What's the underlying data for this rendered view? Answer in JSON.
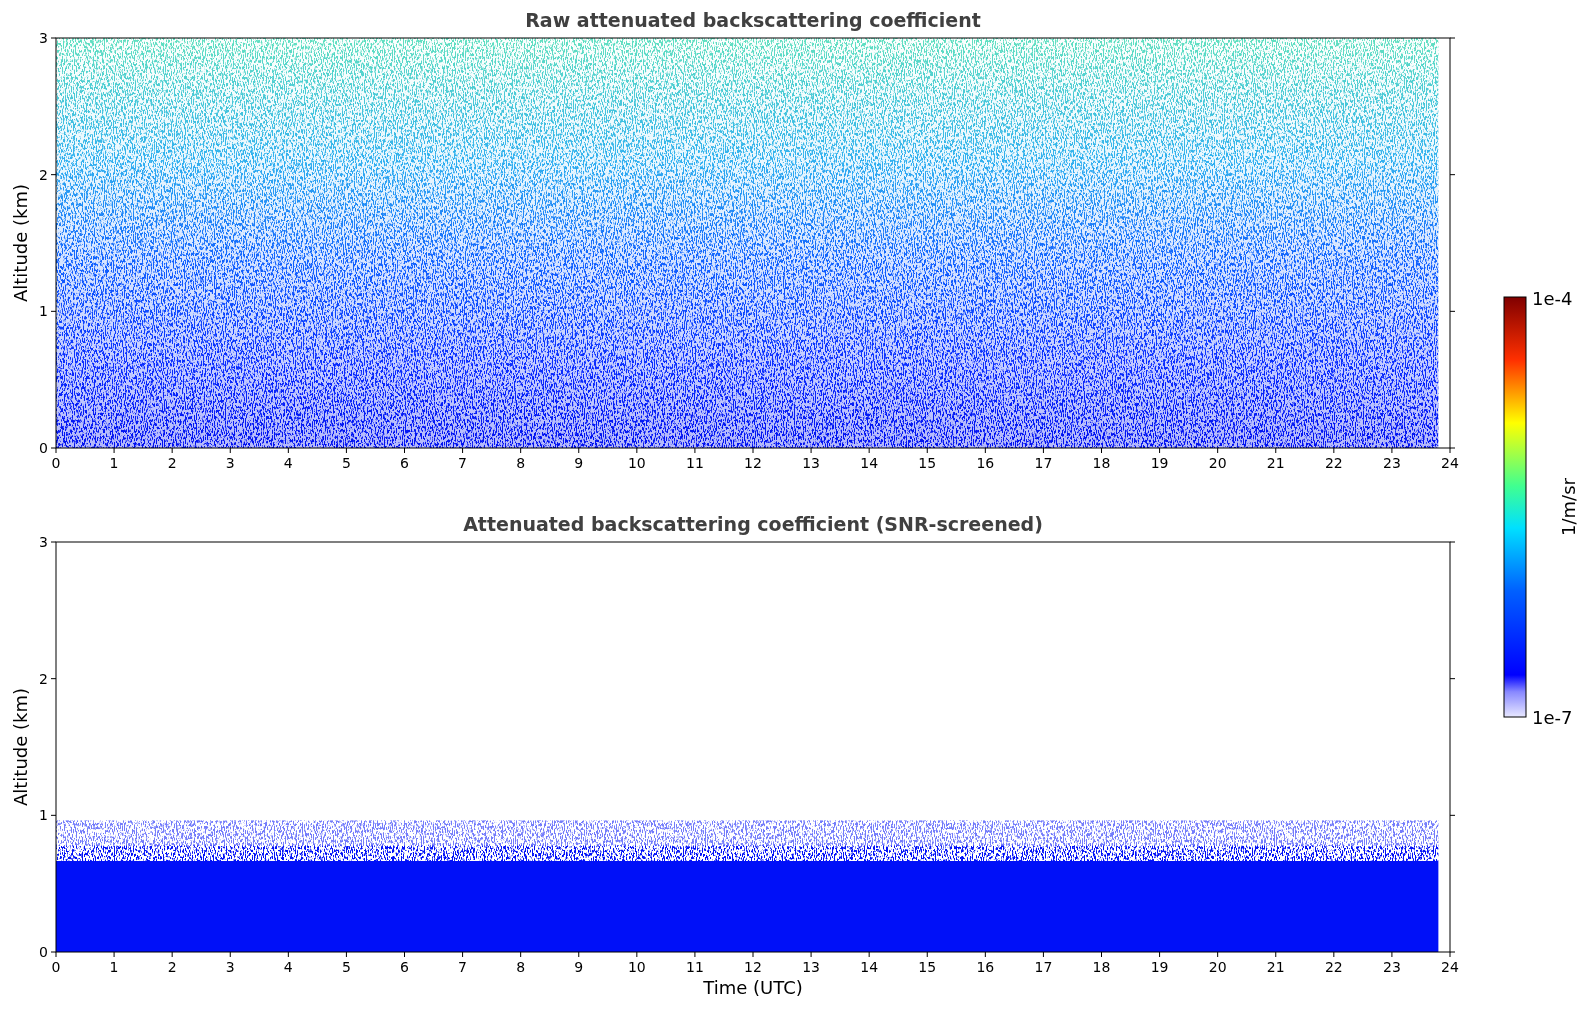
{
  "panels": [
    {
      "kind": "raw",
      "title": "Raw attenuated backscattering coefficient",
      "ylabel": "Altitude (km)",
      "yticks": [
        "3",
        "2",
        "1",
        "0"
      ],
      "xticks": [
        "0",
        "1",
        "2",
        "3",
        "4",
        "5",
        "6",
        "7",
        "8",
        "9",
        "10",
        "11",
        "12",
        "13",
        "14",
        "15",
        "16",
        "17",
        "18",
        "19",
        "20",
        "21",
        "22",
        "23",
        "24"
      ]
    },
    {
      "kind": "screened",
      "title": "Attenuated backscattering coefficient (SNR-screened)",
      "ylabel": "Altitude (km)",
      "xlabel": "Time (UTC)",
      "yticks": [
        "3",
        "2",
        "1",
        "0"
      ],
      "xticks": [
        "0",
        "1",
        "2",
        "3",
        "4",
        "5",
        "6",
        "7",
        "8",
        "9",
        "10",
        "11",
        "12",
        "13",
        "14",
        "15",
        "16",
        "17",
        "18",
        "19",
        "20",
        "21",
        "22",
        "23",
        "24"
      ]
    }
  ],
  "colorbar": {
    "max_label": "1e-4",
    "min_label": "1e-7",
    "label": "1/m/sr"
  }
}
